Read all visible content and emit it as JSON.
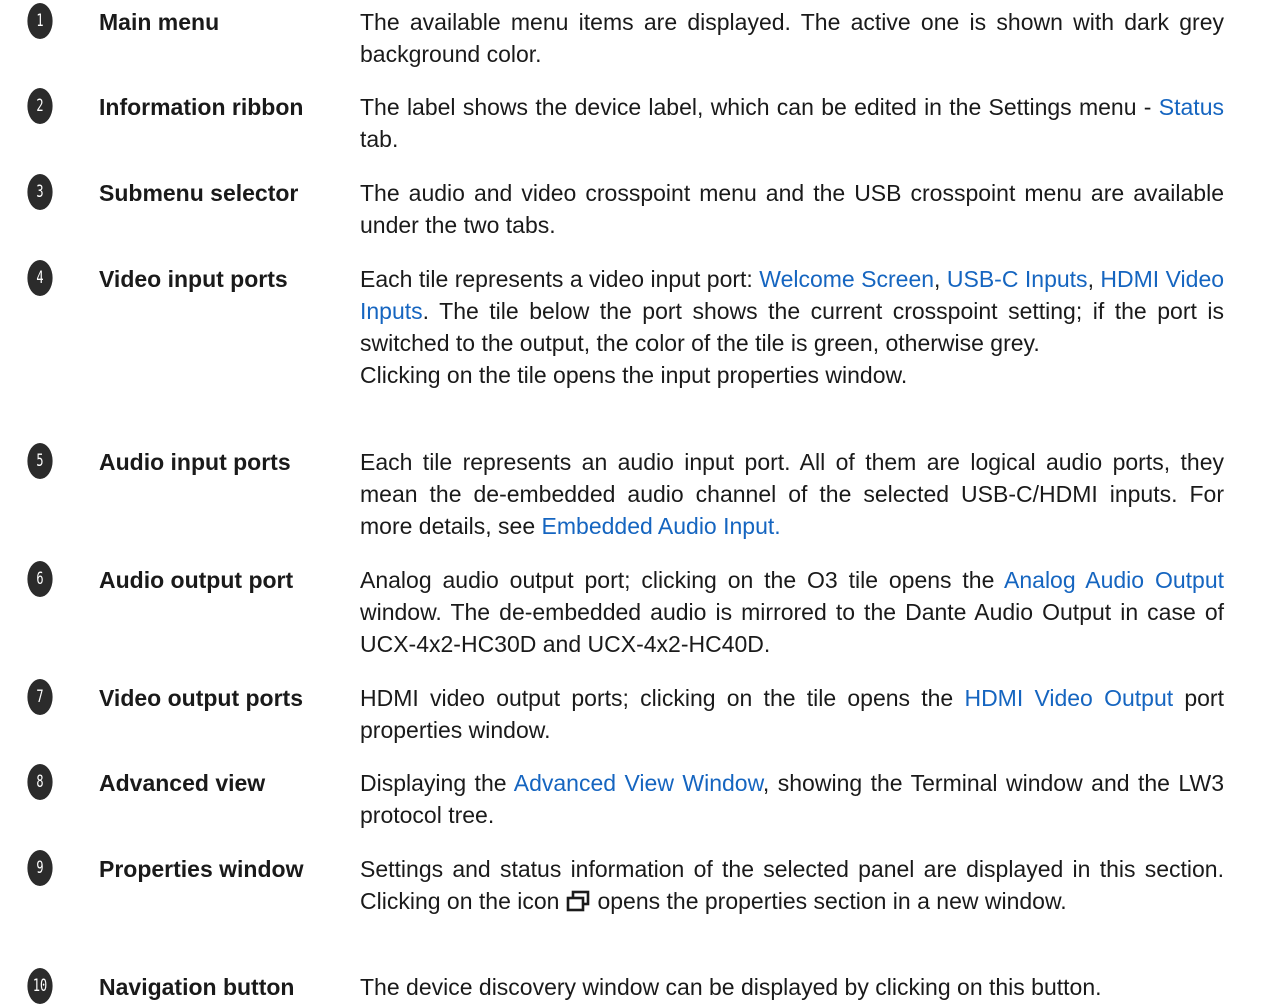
{
  "items": [
    {
      "num": "1",
      "term": "Main menu",
      "d": [
        "The available menu items are displayed. The active one is shown with dark grey background color."
      ]
    },
    {
      "num": "2",
      "term": "Information ribbon",
      "d": [
        "The label shows the device label, which can be edited in the Settings menu - ",
        "Status",
        " tab."
      ]
    },
    {
      "num": "3",
      "term": "Submenu selector",
      "d": [
        "The audio and video crosspoint menu and the USB crosspoint menu are available under the two tabs."
      ]
    },
    {
      "num": "4",
      "term": "Video input ports",
      "d": [
        "Each tile represents a video input port: ",
        "Welcome Screen",
        ", ",
        "USB-C Inputs",
        ", ",
        "HDMI Video Inputs",
        ". The tile below the port shows the current crosspoint setting; if the port is switched to the output, the color of the tile is green, otherwise grey."
      ],
      "d2": "Clicking on the tile opens the input properties window."
    },
    {
      "num": "5",
      "term": "Audio input ports",
      "d": [
        "Each tile represents an audio input port. All of them are logical audio ports, they mean the de-embedded audio channel of the selected USB-C/HDMI inputs. For more details, see ",
        "Embedded Audio Input."
      ]
    },
    {
      "num": "6",
      "term": "Audio output port",
      "d": [
        "Analog audio output port; clicking on the O3 tile opens the ",
        "Analog Audio Output",
        " window. The de-embedded audio is mirrored to the Dante Audio Output in case of UCX-4x2-HC30D and UCX-4x2-HC40D."
      ]
    },
    {
      "num": "7",
      "term": "Video output ports",
      "d": [
        "HDMI video output ports; clicking on the tile opens the ",
        "HDMI Video Output",
        " port properties window."
      ]
    },
    {
      "num": "8",
      "term": "Advanced view",
      "d": [
        "Displaying the ",
        "Advanced View Window",
        ", showing the Terminal window and the LW3 protocol tree."
      ]
    },
    {
      "num": "9",
      "term": "Properties window",
      "d": [
        "Settings and status information of the selected panel are displayed in this section. Clicking on the icon",
        "opens the properties section in a new window."
      ]
    },
    {
      "num": "10",
      "term": "Navigation button",
      "d": [
        "The device discovery window can be displayed by clicking on this button."
      ]
    }
  ]
}
